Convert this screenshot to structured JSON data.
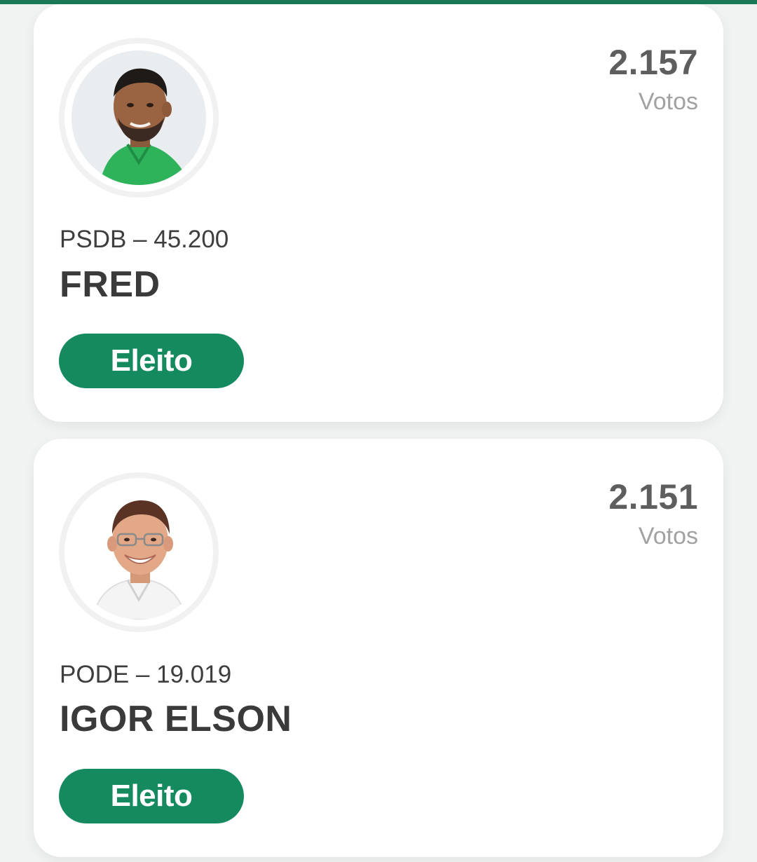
{
  "theme": {
    "accent": "#158a5f",
    "top_bar": "#1a7a57",
    "background": "#f1f2f2"
  },
  "candidates": [
    {
      "votes": "2.157",
      "votes_label": "Votos",
      "party_number": "PSDB – 45.200",
      "name": "FRED",
      "status": "Eleito",
      "photo": "candidate-photo-green-shirt"
    },
    {
      "votes": "2.151",
      "votes_label": "Votos",
      "party_number": "PODE – 19.019",
      "name": "IGOR ELSON",
      "status": "Eleito",
      "photo": "candidate-photo-white-shirt"
    }
  ]
}
